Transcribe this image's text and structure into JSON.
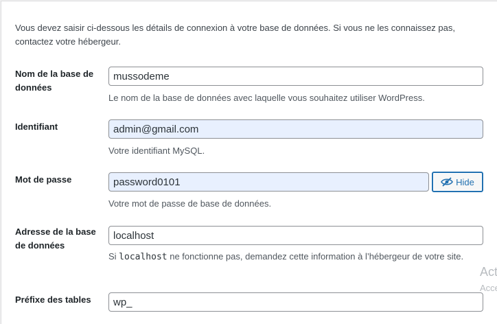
{
  "intro": "Vous devez saisir ci-dessous les détails de connexion à votre base de données. Si vous ne les connaissez pas, contactez votre hébergeur.",
  "fields": {
    "dbname": {
      "label": "Nom de la base de données",
      "value": "mussodeme",
      "description": "Le nom de la base de données avec laquelle vous souhaitez utiliser WordPress."
    },
    "username": {
      "label": "Identifiant",
      "value": "admin@gmail.com",
      "description": "Votre identifiant MySQL."
    },
    "password": {
      "label": "Mot de passe",
      "value": "password0101",
      "description": "Votre mot de passe de base de données.",
      "toggle_label": "Hide",
      "toggle_icon": "eye-slash-icon"
    },
    "dbhost": {
      "label": "Adresse de la base de données",
      "value": "localhost",
      "description_before": "Si ",
      "description_code": "localhost",
      "description_after": " ne fonctionne pas, demandez cette information à l’hébergeur de votre site."
    },
    "prefix": {
      "label": "Préfixe des tables",
      "value": "wp_"
    }
  },
  "watermark": {
    "line1": "Act",
    "line2": "Acce"
  },
  "colors": {
    "accent": "#2271b1",
    "autofill_bg": "#e8f0fe",
    "field_border": "#8c8f94"
  }
}
